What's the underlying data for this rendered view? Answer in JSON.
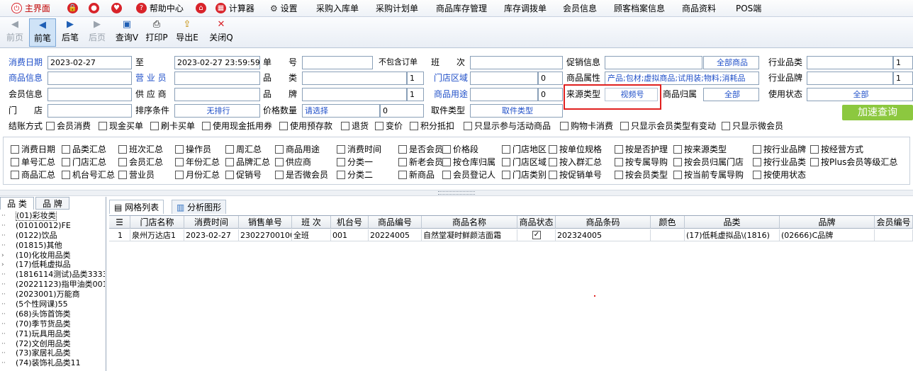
{
  "menubar": {
    "items": [
      "主界面",
      "帮助中心",
      "计算器",
      "设置",
      "采购入库单",
      "采购计划单",
      "商品库存管理",
      "库存调拨单",
      "会员信息",
      "顾客档案信息",
      "商品资料",
      "POS端"
    ]
  },
  "toolbar": {
    "buttons": [
      {
        "label": "前页"
      },
      {
        "label": "前笔"
      },
      {
        "label": "后笔"
      },
      {
        "label": "后页"
      },
      {
        "label": "查询V"
      },
      {
        "label": "打印P"
      },
      {
        "label": "导出E"
      },
      {
        "label": "关闭Q"
      }
    ]
  },
  "filters": {
    "consume_date_label": "消费日期",
    "date_from": "2023-02-27",
    "to_label": "至",
    "date_to": "2023-02-27 23:59:59",
    "order_no_label": "单　　号",
    "not_include_order": "不包含订单",
    "shift_label": "班　　次",
    "promo_label": "促销信息",
    "all_goods": "全部商品",
    "industry_cat_label": "行业品类",
    "industry_cat_val": "1",
    "goods_info_label": "商品信息",
    "salesman_label": "营 业 员",
    "category_label": "品　　类",
    "category_val": "1",
    "store_area_label": "门店区域",
    "store_area_val": "0",
    "goods_attr_label": "商品属性",
    "goods_attr_val": "产品;包材;虚拟商品;试用装;物料;消耗品",
    "industry_brand_label": "行业品牌",
    "industry_brand_val": "1",
    "member_label": "会员信息",
    "supplier_label": "供 应 商",
    "brand_label": "品　　牌",
    "brand_val": "1",
    "goods_use_label": "商品用途",
    "goods_use_val": "0",
    "source_type_label": "来源类型",
    "source_type_val": "视频号",
    "goods_owner_label": "商品归属",
    "goods_owner_val": "全部",
    "use_status_label": "使用状态",
    "use_status_val": "全部",
    "store_label": "门　　店",
    "sort_label": "排序条件",
    "sort_val": "无排行",
    "price_qty_label": "价格数量",
    "price_qty_val": "请选择",
    "price_qty_num": "0",
    "pickup_label": "取件类型",
    "pickup_val": "取件类型",
    "quick_query": "加速查询"
  },
  "settle": {
    "label": "结账方式",
    "options": [
      "会员消费",
      "现金买单",
      "刷卡买单",
      "使用现金抵用券",
      "使用预存款",
      "退货",
      "变价",
      "积分抵扣",
      "只显示参与活动商品",
      "购物卡消费",
      "只显示会员类型有变动",
      "只显示微会员"
    ]
  },
  "groupby": {
    "rows": [
      [
        "消费日期",
        "品类汇总",
        "班次汇总",
        "操作员",
        "周汇总",
        "商品用途",
        "消费时间",
        "是否会员",
        "价格段",
        "门店地区",
        "按单位规格",
        "按是否护理",
        "按来源类型",
        "按行业品牌",
        "按经营方式"
      ],
      [
        "单号汇总",
        "门店汇总",
        "会员汇总",
        "年份汇总",
        "品牌汇总",
        "供应商",
        "分类一",
        "新老会员",
        "按仓库归属",
        "门店区域",
        "按入群汇总",
        "按专属导购",
        "按会员归属门店",
        "按行业品类",
        "按Plus会员等级汇总"
      ],
      [
        "商品汇总",
        "机台号汇总",
        "营业员",
        "月份汇总",
        "促销号",
        "是否微会员",
        "分类二",
        "新商品",
        "会员登记人",
        "门店类别",
        "按促销单号",
        "按会员类型",
        "按当前专属导购",
        "按使用状态"
      ]
    ]
  },
  "left": {
    "tabs": [
      "品 类",
      "品 牌"
    ],
    "tree": [
      "(01)彩妆类",
      "(01010012)FE",
      "(0122)饮品",
      "(01815)其他",
      "(10)化妆用品类",
      "(17)低耗虚拟品",
      "(1816114测试)品类3333",
      "(20221123)指甲油类001",
      "(2023001)万能商",
      "(5个性网课)55",
      "(68)头饰首饰类",
      "(70)季节货品类",
      "(71)玩具用品类",
      "(72)文创用品类",
      "(73)家居礼品类",
      "(74)装饰礼品类11"
    ]
  },
  "grid": {
    "tabs": [
      "网格列表",
      "分析图形"
    ],
    "columns": [
      "门店名称",
      "消费时间",
      "销售单号",
      "班 次",
      "机台号",
      "商品编号",
      "商品名称",
      "商品状态",
      "商品条码",
      "颜色",
      "品类",
      "品牌",
      "会员编号"
    ],
    "rows": [
      {
        "idx": "1",
        "cells": [
          "泉州万达店1",
          "2023-02-27",
          "23022700100",
          "全班",
          "001",
          "20224005",
          "自然堂凝时鲜颜洁面霜",
          "",
          "202324005",
          "",
          "(17)低耗虚拟品\\(1816)",
          "(02666)C品牌",
          ""
        ]
      }
    ]
  }
}
